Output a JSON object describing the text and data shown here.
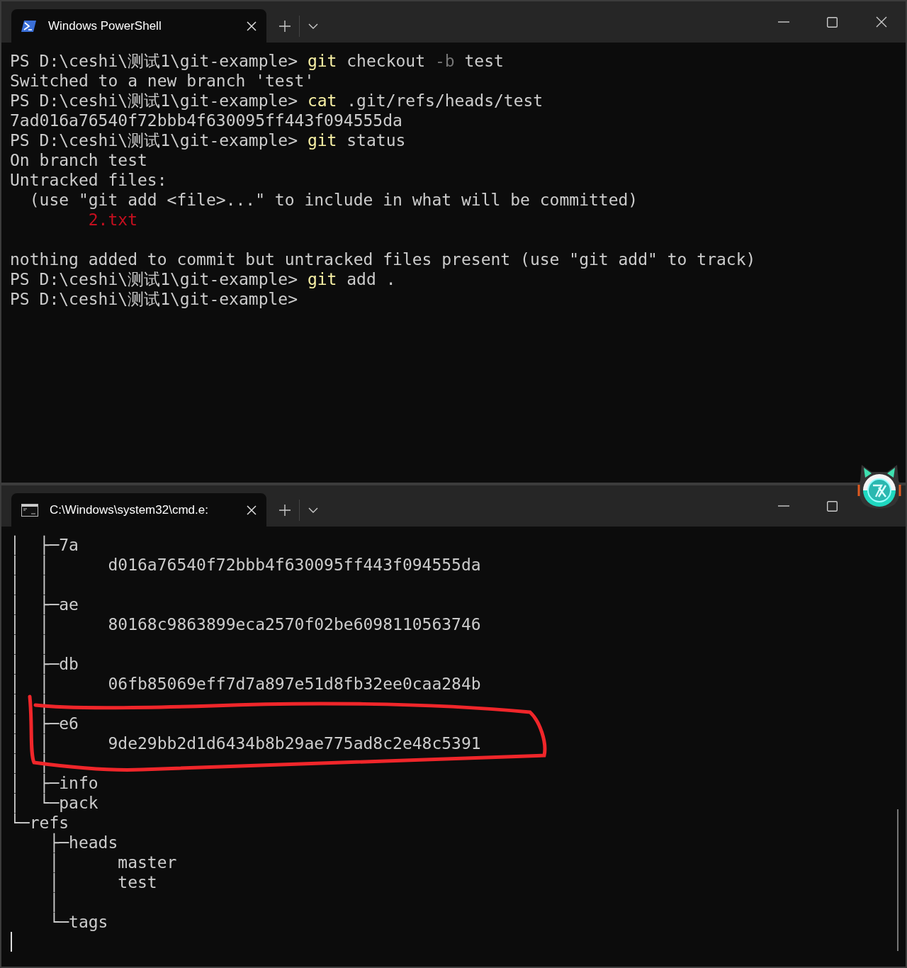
{
  "windows": [
    {
      "kind": "powershell",
      "tab_title": "Windows PowerShell",
      "lines": [
        {
          "segments": [
            {
              "kind": "plain",
              "text": "PS D:\\ceshi\\测试1\\git-example> "
            },
            {
              "kind": "command",
              "text": "git"
            },
            {
              "kind": "plain",
              "text": " checkout "
            },
            {
              "kind": "dim",
              "text": "-b"
            },
            {
              "kind": "plain",
              "text": " test"
            }
          ]
        },
        {
          "segments": [
            {
              "kind": "plain",
              "text": "Switched to a new branch 'test'"
            }
          ]
        },
        {
          "segments": [
            {
              "kind": "plain",
              "text": "PS D:\\ceshi\\测试1\\git-example> "
            },
            {
              "kind": "command",
              "text": "cat"
            },
            {
              "kind": "plain",
              "text": " .git/refs/heads/test"
            }
          ]
        },
        {
          "segments": [
            {
              "kind": "plain",
              "text": "7ad016a76540f72bbb4f630095ff443f094555da"
            }
          ]
        },
        {
          "segments": [
            {
              "kind": "plain",
              "text": "PS D:\\ceshi\\测试1\\git-example> "
            },
            {
              "kind": "command",
              "text": "git"
            },
            {
              "kind": "plain",
              "text": " status"
            }
          ]
        },
        {
          "segments": [
            {
              "kind": "plain",
              "text": "On branch test"
            }
          ]
        },
        {
          "segments": [
            {
              "kind": "plain",
              "text": "Untracked files:"
            }
          ]
        },
        {
          "segments": [
            {
              "kind": "plain",
              "text": "  (use \"git add <file>...\" to include in what will be committed)"
            }
          ]
        },
        {
          "segments": [
            {
              "kind": "error",
              "text": "        2.txt"
            }
          ]
        },
        {
          "blank_before": true,
          "segments": [
            {
              "kind": "plain",
              "text": "nothing added to commit but untracked files present (use \"git add\" to track)"
            }
          ]
        },
        {
          "segments": [
            {
              "kind": "plain",
              "text": "PS D:\\ceshi\\测试1\\git-example> "
            },
            {
              "kind": "command",
              "text": "git"
            },
            {
              "kind": "plain",
              "text": " add ."
            }
          ]
        },
        {
          "segments": [
            {
              "kind": "plain",
              "text": "PS D:\\ceshi\\测试1\\git-example>"
            }
          ]
        }
      ]
    },
    {
      "kind": "cmd",
      "tab_title": "C:\\Windows\\system32\\cmd.e:",
      "lines": [
        {
          "segments": [
            {
              "kind": "plain",
              "text": "│  ├─7a"
            }
          ]
        },
        {
          "segments": [
            {
              "kind": "plain",
              "text": "│  │      d016a76540f72bbb4f630095ff443f094555da"
            }
          ]
        },
        {
          "segments": [
            {
              "kind": "plain",
              "text": "│  │"
            }
          ]
        },
        {
          "segments": [
            {
              "kind": "plain",
              "text": "│  ├─ae"
            }
          ]
        },
        {
          "segments": [
            {
              "kind": "plain",
              "text": "│  │      80168c9863899eca2570f02be6098110563746"
            }
          ]
        },
        {
          "segments": [
            {
              "kind": "plain",
              "text": "│  │"
            }
          ]
        },
        {
          "segments": [
            {
              "kind": "plain",
              "text": "│  ├─db"
            }
          ]
        },
        {
          "segments": [
            {
              "kind": "plain",
              "text": "│  │      06fb85069eff7d7a897e51d8fb32ee0caa284b"
            }
          ]
        },
        {
          "segments": [
            {
              "kind": "plain",
              "text": "│  │"
            }
          ]
        },
        {
          "segments": [
            {
              "kind": "plain",
              "text": "│  ├─e6"
            }
          ]
        },
        {
          "segments": [
            {
              "kind": "plain",
              "text": "│  │      9de29bb2d1d6434b8b29ae775ad8c2e48c5391"
            }
          ]
        },
        {
          "segments": [
            {
              "kind": "plain",
              "text": "│  │"
            }
          ]
        },
        {
          "segments": [
            {
              "kind": "plain",
              "text": "│  ├─info"
            }
          ]
        },
        {
          "segments": [
            {
              "kind": "plain",
              "text": "│  └─pack"
            }
          ]
        },
        {
          "segments": [
            {
              "kind": "plain",
              "text": "└─refs"
            }
          ]
        },
        {
          "segments": [
            {
              "kind": "plain",
              "text": "    ├─heads"
            }
          ]
        },
        {
          "segments": [
            {
              "kind": "plain",
              "text": "    │      master"
            }
          ]
        },
        {
          "segments": [
            {
              "kind": "plain",
              "text": "    │      test"
            }
          ]
        },
        {
          "segments": [
            {
              "kind": "plain",
              "text": "    │"
            }
          ]
        },
        {
          "segments": [
            {
              "kind": "plain",
              "text": "    └─tags"
            }
          ]
        }
      ]
    }
  ]
}
